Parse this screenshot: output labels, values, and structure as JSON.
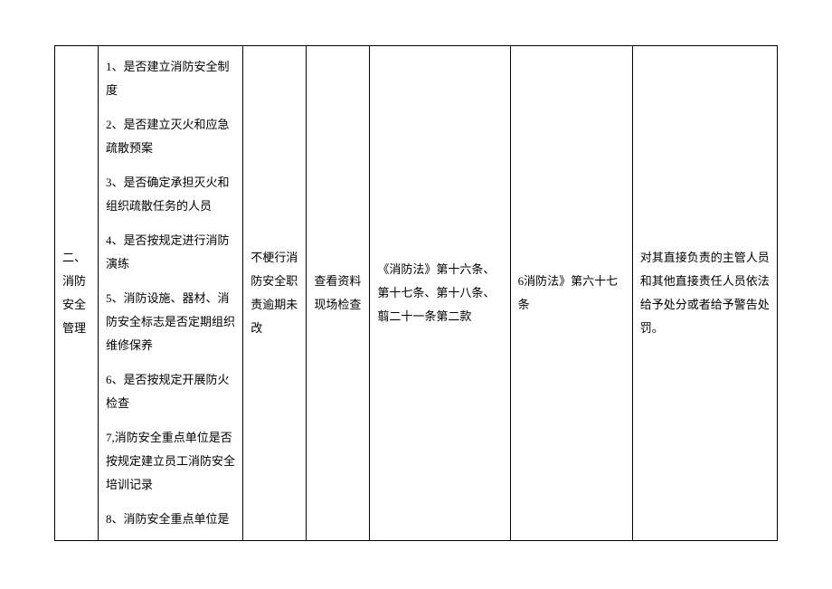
{
  "table": {
    "col1": "二、消防安全管理",
    "col2_items": [
      "1、是否建立消防安全制度",
      "2、是否建立灭火和应急疏散预案",
      "3、是否确定承担灭火和组织疏散任务的人员",
      "4、是否按规定进行消防演练",
      "5、消防设施、器材、消防安全标志是否定期组织维修保养",
      "6、是否按规定开展防火检查",
      "7,消防安全重点单位是否按规定建立员工消防安全培训记录",
      "8、消防安全重点单位是"
    ],
    "col3": "不梗行消防安全职责逾期未改",
    "col4": "查看资料现场检查",
    "col5": "《消防法》第十六条、第十七条、第十八条、翦二十一条第二款",
    "col6": "6消防法》第六十七条",
    "col7": "对其直接负责的主管人员和其他直接责任人员依法给予处分或者给予警告处罚。"
  }
}
